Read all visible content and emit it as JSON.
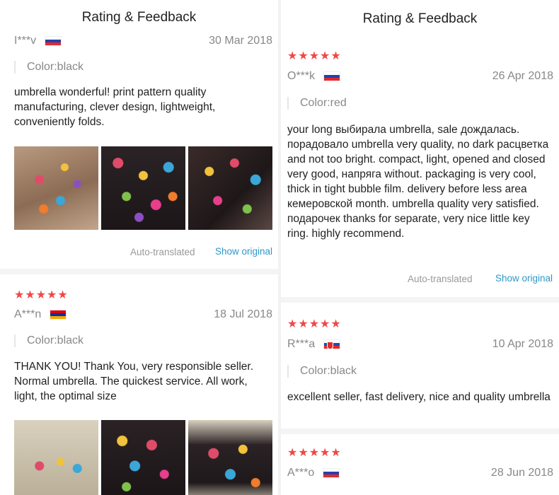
{
  "left": {
    "header": "Rating & Feedback",
    "reviews": [
      {
        "user": "I***v",
        "date": "30 Mar 2018",
        "color": "Color:black",
        "text": "umbrella wonderful! print pattern quality manufacturing, clever design, lightweight, conveniently folds.",
        "auto_translated": "Auto-translated",
        "show_original": "Show original"
      },
      {
        "stars": "★★★★★",
        "user": "A***n",
        "date": "18 Jul 2018",
        "color": "Color:black",
        "text": "THANK YOU! Thank You, very responsible seller. Normal umbrella. The quickest service. All work, light, the optimal size"
      }
    ]
  },
  "right": {
    "header": "Rating & Feedback",
    "reviews": [
      {
        "stars": "★★★★★",
        "user": "O***k",
        "date": "26 Apr 2018",
        "color": "Color:red",
        "text": "your long выбирала umbrella, sale дождалась. порадовало umbrella very quality, no dark расцветка and not too bright. compact, light, opened and closed very good, напряга without. packaging is very cool, thick in tight bubble film. delivery before less area кемеровской month. umbrella quality very satisfied. подарочек thanks for separate, very nice little key ring. highly recommend.",
        "auto_translated": "Auto-translated",
        "show_original": "Show original"
      },
      {
        "stars": "★★★★★",
        "user": "R***a",
        "date": "10 Apr 2018",
        "color": "Color:black",
        "text": "excellent seller, fast delivery, nice and quality umbrella"
      },
      {
        "stars": "★★★★★",
        "user": "A***o",
        "date": "28 Jun 2018"
      }
    ]
  },
  "colors": {
    "star": "#f04848",
    "link": "#2d98c8",
    "muted": "#888888",
    "text": "#222222"
  }
}
